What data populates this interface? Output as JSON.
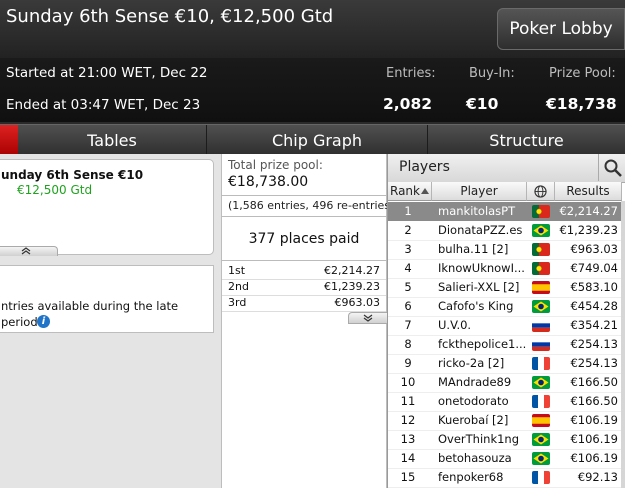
{
  "header": {
    "title": "Sunday 6th Sense €10, €12,500 Gtd",
    "lobby_button": "Poker Lobby"
  },
  "info": {
    "started": "Started at 21:00 WET, Dec 22",
    "ended": "Ended at 03:47 WET, Dec 23",
    "entries_label": "Entries:",
    "entries_value": "2,082",
    "buyin_label": "Buy-In:",
    "buyin_value": "€10",
    "prize_label": "Prize Pool:",
    "prize_value": "€18,738"
  },
  "tabs": {
    "tables": "Tables",
    "chip_graph": "Chip Graph",
    "structure": "Structure"
  },
  "tourney_card": {
    "name": "unday 6th Sense €10",
    "guarantee": "€12,500 Gtd"
  },
  "late_reg": {
    "line1": "ntries available during the late",
    "line2": "period."
  },
  "prize": {
    "total_label": "Total prize pool:",
    "total_value": "€18,738.00",
    "entries_note": "(1,586 entries, 496 re-entries)",
    "places_paid": "377 places paid",
    "payouts": [
      {
        "place": "1st",
        "amount": "€2,214.27"
      },
      {
        "place": "2nd",
        "amount": "€1,239.23"
      },
      {
        "place": "3rd",
        "amount": "€963.03"
      }
    ]
  },
  "players": {
    "title": "Players",
    "col_rank": "Rank",
    "col_player": "Player",
    "col_results": "Results",
    "rows": [
      {
        "rank": "1",
        "name": "mankitolasPT",
        "flag": "portugal",
        "result": "€2,214.27"
      },
      {
        "rank": "2",
        "name": "DionataPZZ.es",
        "flag": "brazil",
        "result": "€1,239.23"
      },
      {
        "rank": "3",
        "name": "bulha.11 [2]",
        "flag": "portugal",
        "result": "€963.03"
      },
      {
        "rank": "4",
        "name": "IknowUknowI...",
        "flag": "portugal",
        "result": "€749.04"
      },
      {
        "rank": "5",
        "name": "Salieri-XXL [2]",
        "flag": "spain",
        "result": "€583.10"
      },
      {
        "rank": "6",
        "name": "Cafofo's King",
        "flag": "brazil",
        "result": "€454.28"
      },
      {
        "rank": "7",
        "name": "U.V.0.",
        "flag": "russia",
        "result": "€354.21"
      },
      {
        "rank": "8",
        "name": "fckthepolice1...",
        "flag": "russia",
        "result": "€254.13"
      },
      {
        "rank": "9",
        "name": "ricko-2a [2]",
        "flag": "france",
        "result": "€254.13"
      },
      {
        "rank": "10",
        "name": "MAndrade89",
        "flag": "brazil",
        "result": "€166.50"
      },
      {
        "rank": "11",
        "name": "onetodorato",
        "flag": "france",
        "result": "€166.50"
      },
      {
        "rank": "12",
        "name": "Kuerobaí [2]",
        "flag": "spain",
        "result": "€106.19"
      },
      {
        "rank": "13",
        "name": "OverThink1ng",
        "flag": "brazil",
        "result": "€106.19"
      },
      {
        "rank": "14",
        "name": "betohasouza",
        "flag": "brazil",
        "result": "€106.19"
      },
      {
        "rank": "15",
        "name": "fenpoker68",
        "flag": "france",
        "result": "€92.13"
      }
    ]
  },
  "colors": {
    "green_text": "#1fa31f",
    "selected_row": "#8a8a8a",
    "red_tab": "#cc1111"
  },
  "icons": [
    "search-icon",
    "globe-icon",
    "sort-arrow-icon",
    "info-icon",
    "chevron-up-icon",
    "chevron-down-icon"
  ]
}
